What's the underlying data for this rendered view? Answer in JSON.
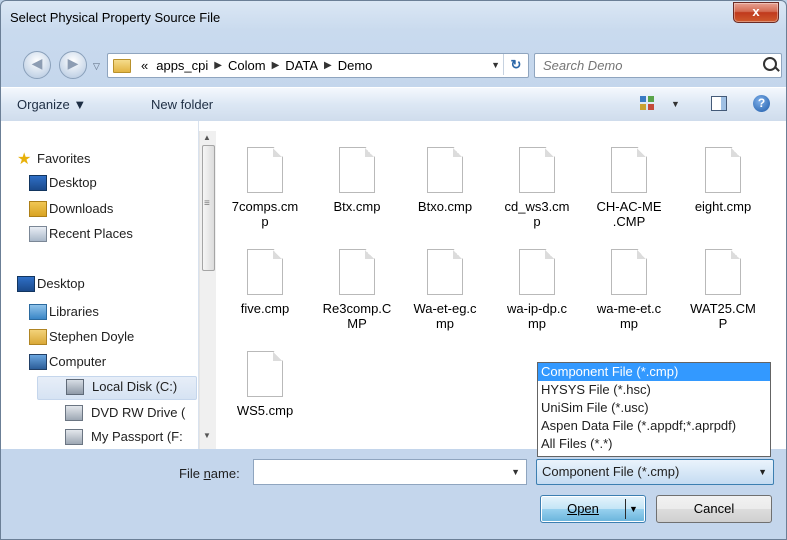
{
  "window": {
    "title": "Select Physical Property Source File",
    "close_glyph": "x"
  },
  "nav": {
    "back_glyph": "◀",
    "forward_glyph": "▶",
    "history_glyph": "▽",
    "breadcrumb_prefix": "«",
    "breadcrumbs": [
      "apps_cpi",
      "Colom",
      "DATA",
      "Demo"
    ],
    "separator": "▶",
    "dropdown_glyph": "▼",
    "refresh_glyph": "↻",
    "search_placeholder": "Search Demo"
  },
  "toolbar": {
    "organize_label": "Organize ▼",
    "new_folder_label": "New folder",
    "view_drop_glyph": "▼",
    "help_glyph": "?"
  },
  "sidebar": {
    "items": [
      {
        "label": "Favorites",
        "icon": "star-icon"
      },
      {
        "label": "Desktop",
        "icon": "desktop-icon"
      },
      {
        "label": "Downloads",
        "icon": "downloads-icon"
      },
      {
        "label": "Recent Places",
        "icon": "recent-places-icon"
      },
      {
        "label": "Desktop",
        "icon": "desktop-icon"
      },
      {
        "label": "Libraries",
        "icon": "libraries-icon"
      },
      {
        "label": "Stephen Doyle",
        "icon": "user-icon"
      },
      {
        "label": "Computer",
        "icon": "computer-icon"
      },
      {
        "label": "Local Disk (C:)",
        "icon": "hard-disk-icon"
      },
      {
        "label": "DVD RW Drive (",
        "icon": "dvd-drive-icon"
      },
      {
        "label": "My Passport (F:",
        "icon": "external-drive-icon"
      }
    ],
    "scroll_up": "▲",
    "scroll_down": "▼",
    "grip": "≡"
  },
  "files": [
    "7comps.cmp",
    "Btx.cmp",
    "Btxo.cmp",
    "cd_ws3.cmp",
    "CH-AC-ME.CMP",
    "eight.cmp",
    "five.cmp",
    "Re3comp.CMP",
    "Wa-et-eg.cmp",
    "wa-ip-dp.cmp",
    "wa-me-et.cmp",
    "WAT25.CMP",
    "WS5.cmp"
  ],
  "file_display": [
    [
      "7comps.cm",
      "p"
    ],
    [
      "Btx.cmp",
      ""
    ],
    [
      "Btxo.cmp",
      ""
    ],
    [
      "cd_ws3.cm",
      "p"
    ],
    [
      "CH-AC-ME",
      ".CMP"
    ],
    [
      "eight.cmp",
      ""
    ],
    [
      "five.cmp",
      ""
    ],
    [
      "Re3comp.C",
      "MP"
    ],
    [
      "Wa-et-eg.c",
      "mp"
    ],
    [
      "wa-ip-dp.c",
      "mp"
    ],
    [
      "wa-me-et.c",
      "mp"
    ],
    [
      "WAT25.CM",
      "P"
    ],
    [
      "WS5.cmp",
      ""
    ]
  ],
  "filter_options": [
    "Component File (*.cmp)",
    "HYSYS File (*.hsc)",
    "UniSim File (*.usc)",
    "Aspen Data File (*.appdf;*.aprpdf)",
    "All Files (*.*)"
  ],
  "bottom": {
    "file_name_label_pre": "File ",
    "file_name_label_u": "n",
    "file_name_label_post": "ame:",
    "file_name_value": "",
    "file_type_selected": "Component File (*.cmp)",
    "drop_glyph": "▼",
    "open_label": "Open",
    "cancel_label": "Cancel"
  }
}
